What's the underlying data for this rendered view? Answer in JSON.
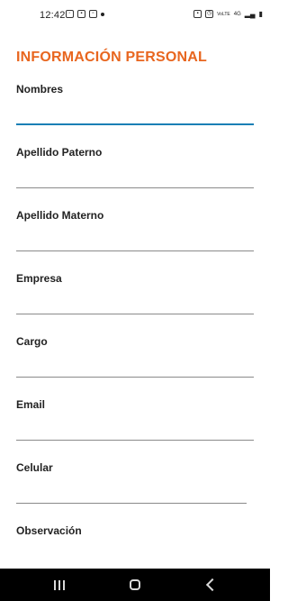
{
  "status_bar": {
    "time": "12:42",
    "left_icons": [
      "whatsapp-icon",
      "chat-icon",
      "calendar-icon",
      "dot-icon"
    ],
    "right_icons": [
      "battery-saver-icon",
      "alarm-icon",
      "volte-icon",
      "signal-4g-icon",
      "signal-bars-icon",
      "battery-icon"
    ],
    "volte_text": "VoLTE",
    "net_text": "4G"
  },
  "form": {
    "title": "INFORMACIÓN PERSONAL",
    "fields": [
      {
        "label": "Nombres",
        "value": "",
        "placeholder": ""
      },
      {
        "label": "Apellido Paterno",
        "value": "",
        "placeholder": ""
      },
      {
        "label": "Apellido Materno",
        "value": "",
        "placeholder": ""
      },
      {
        "label": "Empresa",
        "value": "",
        "placeholder": ""
      },
      {
        "label": "Cargo",
        "value": "",
        "placeholder": ""
      },
      {
        "label": "Email",
        "value": "",
        "placeholder": ""
      },
      {
        "label": "Celular",
        "value": "",
        "placeholder": ""
      },
      {
        "label": "Observación",
        "value": "",
        "placeholder": ""
      }
    ]
  },
  "nav_bar": {
    "buttons": [
      "recent-apps",
      "home",
      "back"
    ]
  },
  "colors": {
    "title": "#e8661f",
    "active_underline": "#1a7fb5",
    "underline": "#8a8a8a",
    "nav_bg": "#000000"
  }
}
